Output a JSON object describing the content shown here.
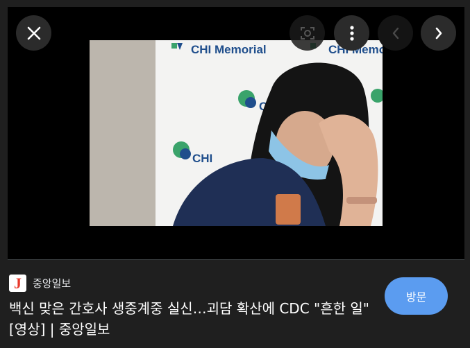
{
  "viewer": {
    "close_label": "close-icon",
    "lens_icon": "lens-icon",
    "more_icon": "more-vert-icon",
    "prev_icon": "chevron-left-icon",
    "next_icon": "chevron-right-icon"
  },
  "photo": {
    "backdrop_text": "CHI Memorial",
    "backdrop_text_2": "CHI",
    "brand_color": "#1f4e8c",
    "accent_green": "#3aa36b"
  },
  "result": {
    "source_logo_letter": "J",
    "source_logo_color": "#e8392b",
    "source_name": "중앙일보",
    "title": "백신 맞은 간호사 생중계중 실신…괴담 확산에 CDC \"흔한 일\" [영상] | 중앙일보",
    "visit_label": "방문",
    "visit_color": "#5b9cf0"
  }
}
